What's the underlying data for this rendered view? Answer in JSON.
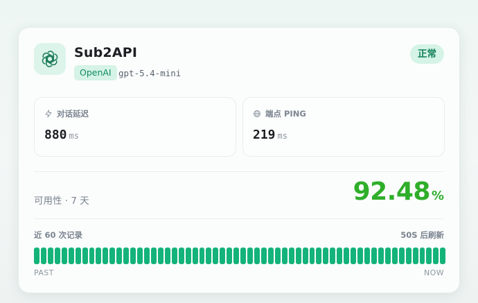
{
  "service": {
    "name": "Sub2API",
    "provider": "OpenAI",
    "model": "gpt-5.4-mini",
    "status": "正常",
    "logo_icon": "openai-logo-icon"
  },
  "metrics": [
    {
      "label": "对话延迟",
      "value": "880",
      "unit": "ms",
      "icon": "lightning-icon"
    },
    {
      "label": "端点 PING",
      "value": "219",
      "unit": "ms",
      "icon": "globe-icon"
    }
  ],
  "availability": {
    "label": "可用性 · 7 天",
    "value": "92.48",
    "unit": "%"
  },
  "history": {
    "label": "近 60 次记录",
    "refresh": "50S 后刷新",
    "count": 60,
    "past_label": "PAST",
    "now_label": "NOW"
  },
  "colors": {
    "accent": "#14b37a",
    "availability": "#2fae2a",
    "badge_bg": "#d5f3e6",
    "badge_text": "#0f7f56"
  }
}
